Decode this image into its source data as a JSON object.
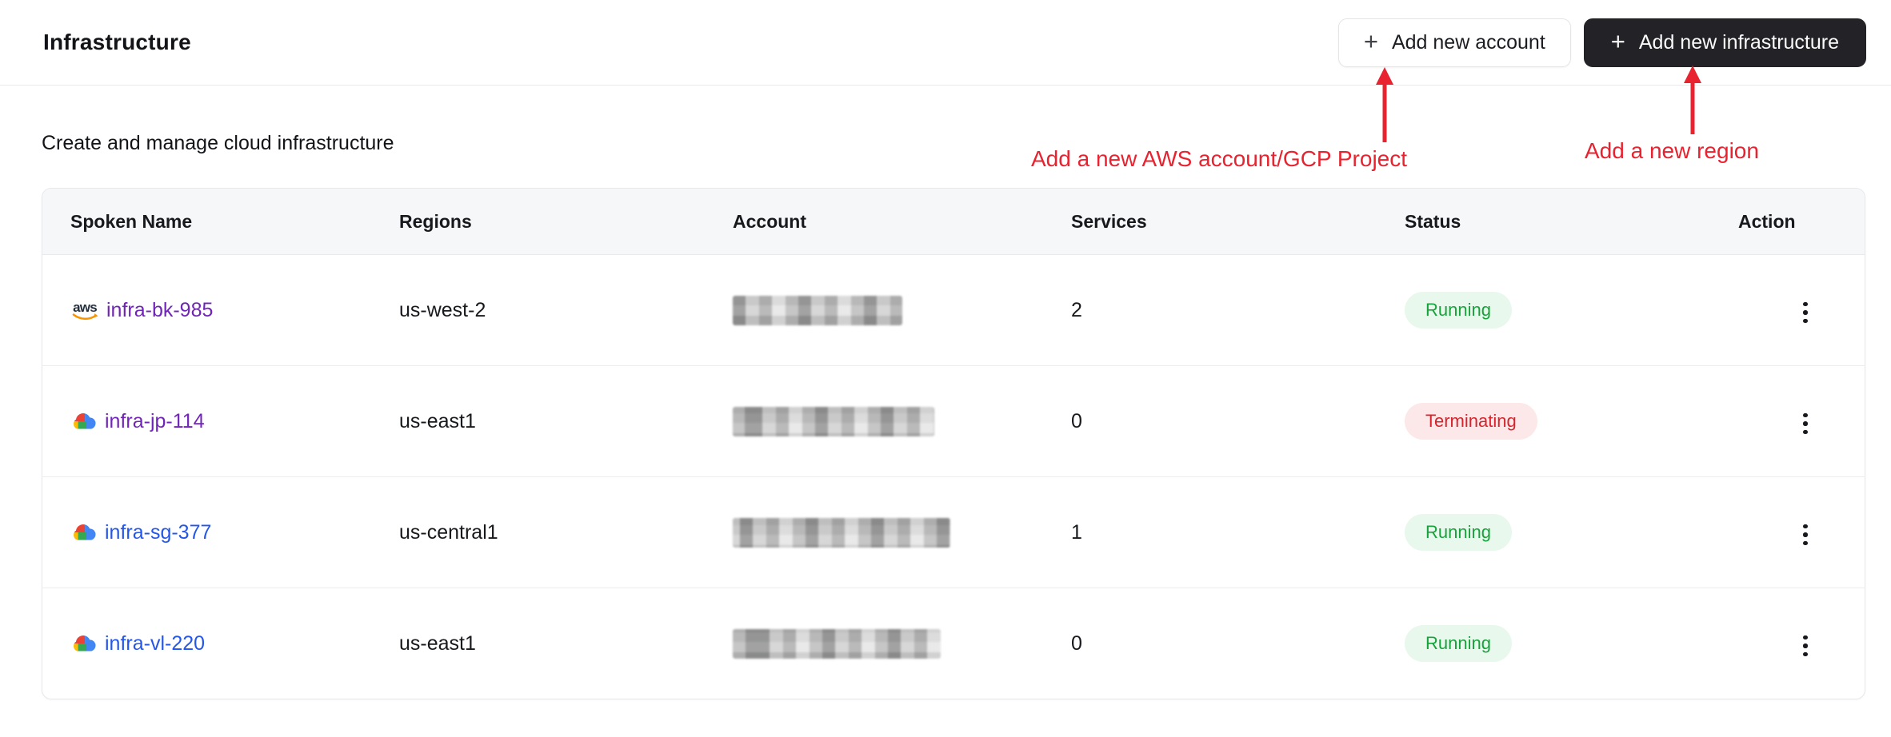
{
  "page": {
    "title": "Infrastructure",
    "subtitle": "Create and manage cloud infrastructure"
  },
  "toolbar": {
    "plus": "+",
    "add_account_label": "Add new account",
    "add_infrastructure_label": "Add new infrastructure"
  },
  "annotations": [
    {
      "text": "Add a new AWS account/GCP Project",
      "points_to": "add-account-button"
    },
    {
      "text": "Add a new region",
      "points_to": "add-infrastructure-button"
    }
  ],
  "table": {
    "columns": [
      "Spoken Name",
      "Regions",
      "Account",
      "Services",
      "Status",
      "Action"
    ],
    "rows": [
      {
        "provider": "aws",
        "name": "infra-bk-985",
        "link_color": "purple",
        "region": "us-west-2",
        "account_redacted": true,
        "services": "2",
        "status": {
          "label": "Running",
          "tone": "green"
        }
      },
      {
        "provider": "gcp",
        "name": "infra-jp-114",
        "link_color": "purple",
        "region": "us-east1",
        "account_redacted": true,
        "services": "0",
        "status": {
          "label": "Terminating",
          "tone": "red"
        }
      },
      {
        "provider": "gcp",
        "name": "infra-sg-377",
        "link_color": "blue",
        "region": "us-central1",
        "account_redacted": true,
        "services": "1",
        "status": {
          "label": "Running",
          "tone": "green"
        }
      },
      {
        "provider": "gcp",
        "name": "infra-vl-220",
        "link_color": "blue",
        "region": "us-east1",
        "account_redacted": true,
        "services": "0",
        "status": {
          "label": "Running",
          "tone": "green"
        }
      }
    ]
  },
  "colors": {
    "annotation_red": "#e8232f",
    "running_bg": "#e8f8ec",
    "running_text": "#18a23b",
    "terminating_bg": "#fce8e8",
    "terminating_text": "#d8232c",
    "link_purple": "#7125b8",
    "link_blue": "#2457e8",
    "dark_button_bg": "#232327",
    "header_row_bg": "#f6f7f9",
    "aws_orange": "#f79400",
    "gcp_red": "#ea4335",
    "gcp_blue": "#4285f4",
    "gcp_yellow": "#fbbc05",
    "gcp_green": "#34a853"
  }
}
